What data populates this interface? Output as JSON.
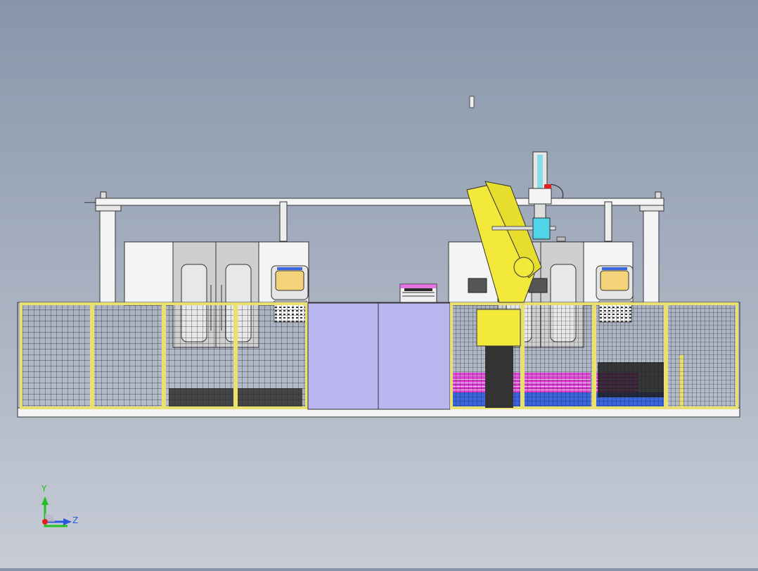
{
  "scene": {
    "description_colors": {
      "frame_yellow": "#e8e070",
      "robot_yellow": "#f2e93a",
      "mesh_dark": "#2a2a2a",
      "machine_white": "#f4f4f4",
      "machine_grey": "#cfcfcf",
      "opening_lavender": "#b9b6f0",
      "pallet_magenta": "#e040d8",
      "pallet_blue": "#3a66e0",
      "cyan_accent": "#4fd4e8",
      "screen_yellow": "#f3d27a"
    }
  },
  "triad": {
    "y_label": "Y",
    "z_label": "Z",
    "y_color": "#22c022",
    "z_color": "#2a56e0",
    "x_color": "#e02020"
  }
}
